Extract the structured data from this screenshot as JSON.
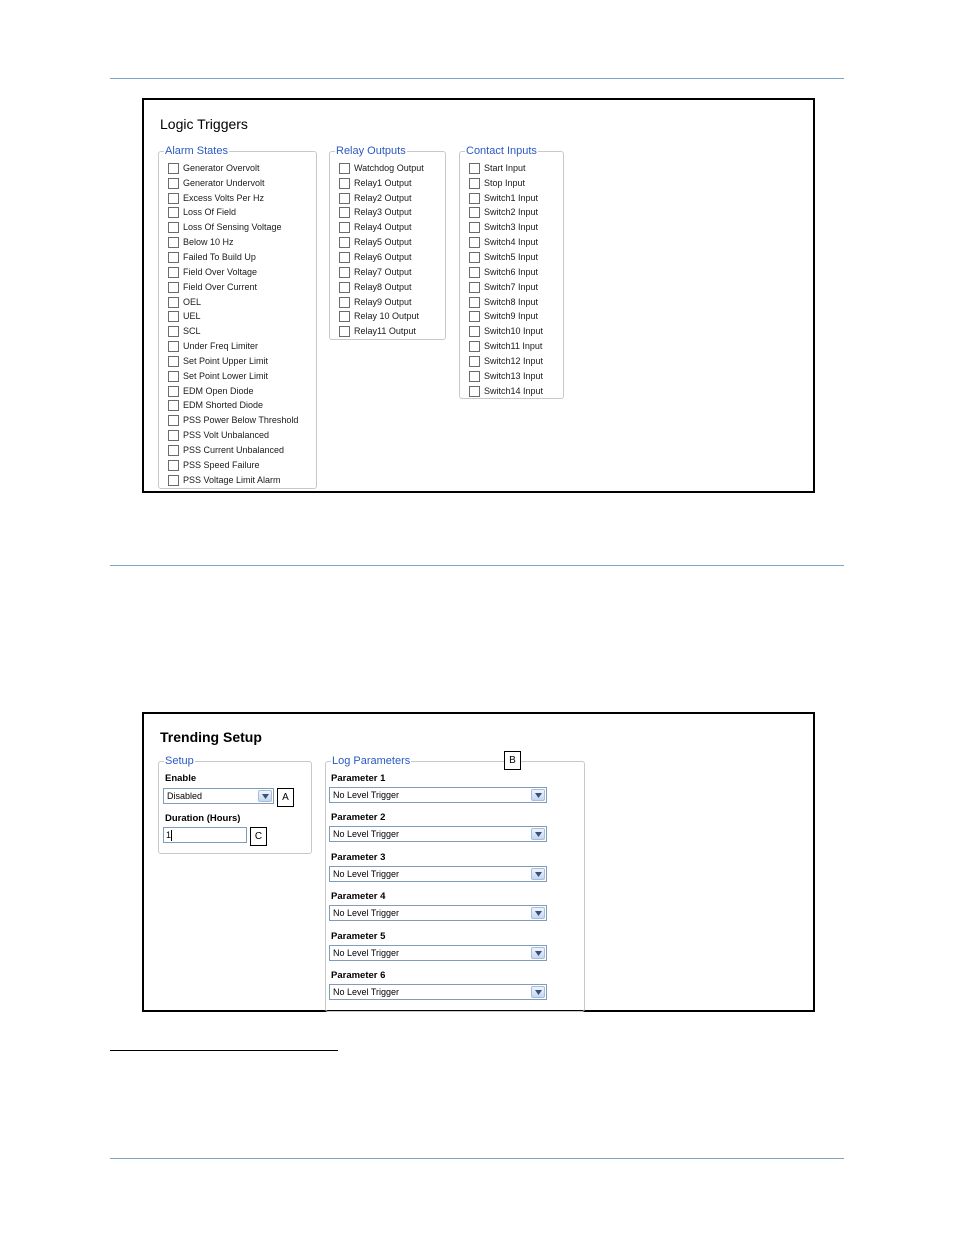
{
  "logic_triggers": {
    "title": "Logic Triggers",
    "alarm_states": {
      "legend": "Alarm States",
      "items": [
        "Generator Overvolt",
        "Generator Undervolt",
        "Excess Volts Per Hz",
        "Loss Of Field",
        "Loss Of Sensing Voltage",
        "Below 10 Hz",
        "Failed To Build Up",
        "Field Over Voltage",
        "Field Over Current",
        "OEL",
        "UEL",
        "SCL",
        "Under Freq Limiter",
        "Set Point Upper Limit",
        "Set Point Lower Limit",
        "EDM Open Diode",
        "EDM Shorted Diode",
        "PSS Power Below Threshold",
        "PSS Volt Unbalanced",
        "PSS Current Unbalanced",
        "PSS Speed Failure",
        "PSS Voltage Limit Alarm"
      ]
    },
    "relay_outputs": {
      "legend": "Relay Outputs",
      "items": [
        "Watchdog Output",
        "Relay1 Output",
        "Relay2 Output",
        "Relay3 Output",
        "Relay4 Output",
        "Relay5 Output",
        "Relay6 Output",
        "Relay7 Output",
        "Relay8 Output",
        "Relay9 Output",
        "Relay 10 Output",
        "Relay11 Output"
      ]
    },
    "contact_inputs": {
      "legend": "Contact Inputs",
      "items": [
        "Start Input",
        "Stop Input",
        "Switch1 Input",
        "Switch2 Input",
        "Switch3 Input",
        "Switch4 Input",
        "Switch5 Input",
        "Switch6 Input",
        "Switch7 Input",
        "Switch8 Input",
        "Switch9 Input",
        "Switch10 Input",
        "Switch11 Input",
        "Switch12 Input",
        "Switch13 Input",
        "Switch14 Input"
      ]
    }
  },
  "trending_setup": {
    "title": "Trending Setup",
    "setup": {
      "legend": "Setup",
      "enable_label": "Enable",
      "enable_value": "Disabled",
      "duration_label": "Duration (Hours)",
      "duration_value": "1"
    },
    "log_parameters": {
      "legend": "Log Parameters",
      "parameters": [
        {
          "label": "Parameter 1",
          "value": "No Level Trigger"
        },
        {
          "label": "Parameter 2",
          "value": "No Level Trigger"
        },
        {
          "label": "Parameter 3",
          "value": "No Level Trigger"
        },
        {
          "label": "Parameter 4",
          "value": "No Level Trigger"
        },
        {
          "label": "Parameter 5",
          "value": "No Level Trigger"
        },
        {
          "label": "Parameter 6",
          "value": "No Level Trigger"
        }
      ]
    },
    "callouts": {
      "a": "A",
      "b": "B",
      "c": "C"
    }
  },
  "colors": {
    "rule": "#7ea6c4",
    "legend_text": "#2b59c3"
  }
}
